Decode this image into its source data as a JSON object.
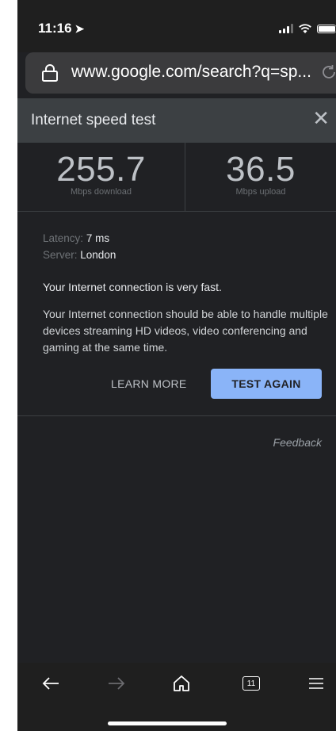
{
  "status": {
    "time": "11:16",
    "location_icon": "location-arrow-icon"
  },
  "browser": {
    "url": "www.google.com/search?q=sp...",
    "tab_count": "11"
  },
  "widget": {
    "title": "Internet speed test",
    "download": {
      "value": "255.7",
      "unit": "Mbps download"
    },
    "upload": {
      "value": "36.5",
      "unit": "Mbps upload"
    },
    "latency_label": "Latency:",
    "latency_value": "7 ms",
    "server_label": "Server:",
    "server_value": "London",
    "headline": "Your Internet connection is very fast.",
    "description": "Your Internet connection should be able to handle multiple devices streaming HD videos, video conferencing and gaming at the same time.",
    "learn_more": "LEARN MORE",
    "test_again": "TEST AGAIN",
    "feedback": "Feedback"
  },
  "colors": {
    "background": "#202124",
    "header": "#3c4043",
    "accent": "#8ab4f8"
  }
}
